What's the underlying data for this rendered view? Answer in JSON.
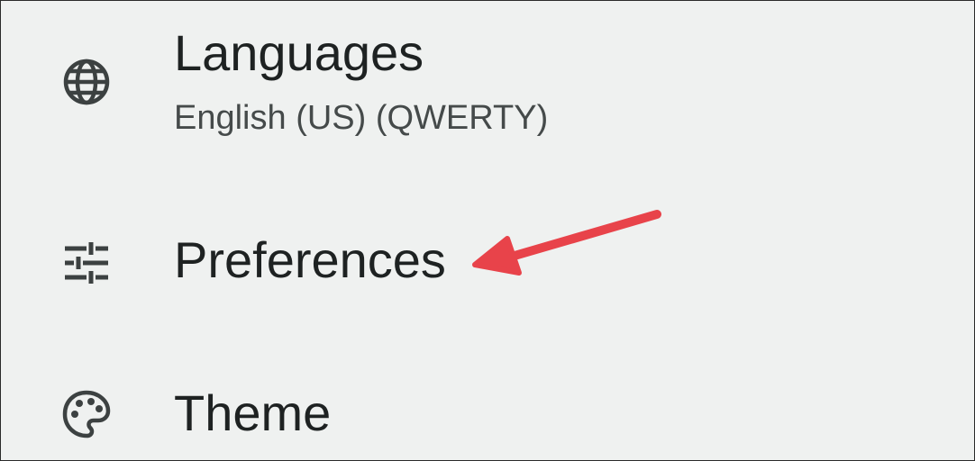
{
  "settings": {
    "items": [
      {
        "title": "Languages",
        "subtitle": "English (US) (QWERTY)",
        "icon": "globe-icon"
      },
      {
        "title": "Preferences",
        "icon": "sliders-icon"
      },
      {
        "title": "Theme",
        "icon": "palette-icon"
      }
    ]
  },
  "colors": {
    "background": "#eff1f0",
    "title_text": "#1e2222",
    "subtitle_text": "#454a4a",
    "icon": "#3c4141",
    "annotation_arrow": "#e8434a"
  }
}
